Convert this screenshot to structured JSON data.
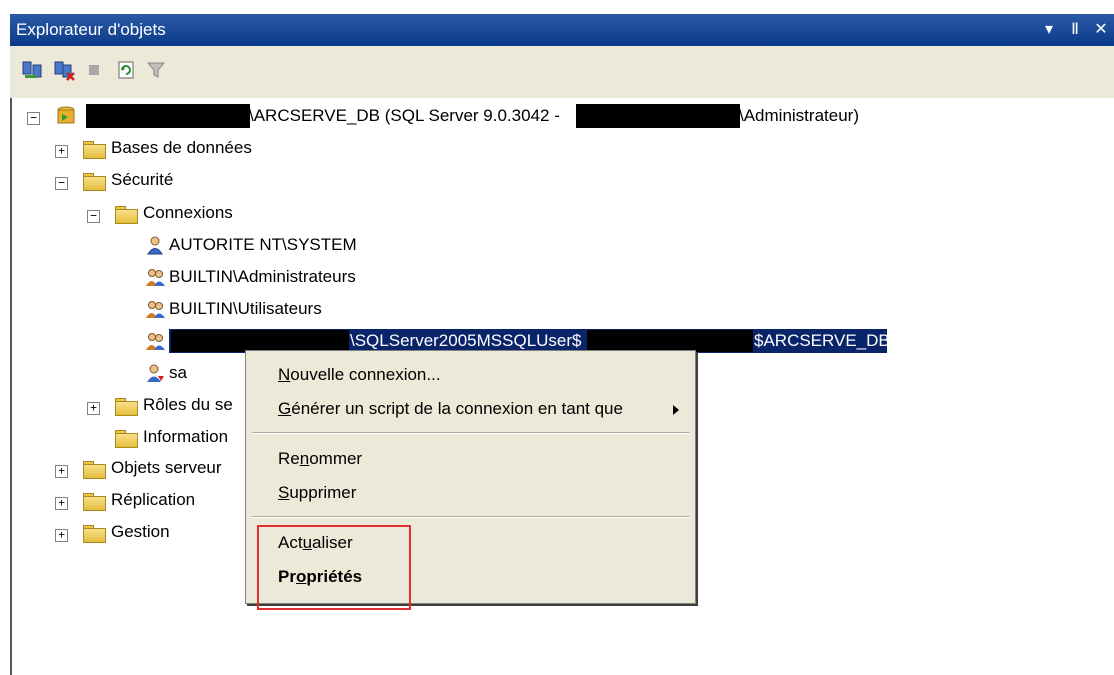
{
  "window": {
    "title": "Explorateur d'objets",
    "controls": [
      "▾",
      "Ⅱ",
      "✕"
    ]
  },
  "toolbar": {
    "icons": [
      "connect-icon",
      "disconnect-icon",
      "stop-icon",
      "refresh-icon",
      "filter-icon"
    ]
  },
  "tree": {
    "server": {
      "label_mid": "\\ARCSERVE_DB (SQL Server 9.0.3042 -",
      "label_end": "\\Administrateur)"
    },
    "databases": "Bases de données",
    "security": "Sécurité",
    "logins": "Connexions",
    "login_items": [
      "AUTORITE NT\\SYSTEM",
      "BUILTIN\\Administrateurs",
      "BUILTIN\\Utilisateurs"
    ],
    "selected_login": {
      "mid": "\\SQLServer2005MSSQLUser$",
      "end": "$ARCSERVE_DB"
    },
    "sa": "sa",
    "server_roles": "Rôles du se",
    "credentials": "Information",
    "server_objects": "Objets serveur",
    "replication": "Réplication",
    "management": "Gestion"
  },
  "context_menu": {
    "new_login": {
      "underline": "N",
      "rest": "ouvelle connexion..."
    },
    "script_login": {
      "underline": "G",
      "rest": "énérer un script de la connexion en tant que"
    },
    "rename": {
      "pre": "Re",
      "underline": "n",
      "rest": "ommer"
    },
    "delete": {
      "underline": "S",
      "rest": "upprimer"
    },
    "refresh": {
      "pre": "Act",
      "underline": "u",
      "rest": "aliser"
    },
    "properties": {
      "pre": "Pr",
      "underline": "o",
      "rest": "priétés"
    }
  },
  "colors": {
    "titlebar": "#0a3a8a",
    "selection": "#0a246a",
    "highlight_box": "#e03030",
    "menu_bg": "#ece9d8"
  }
}
